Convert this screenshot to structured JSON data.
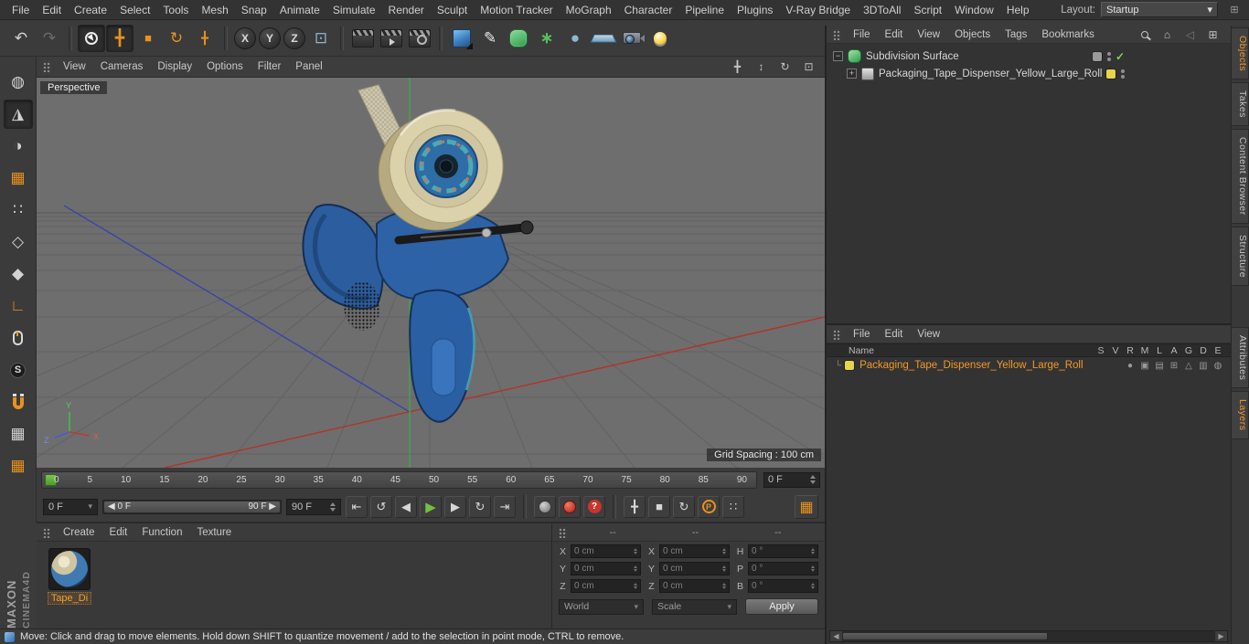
{
  "glyphs": {
    "dropdown": "▾",
    "left": "◀",
    "right": "▶"
  },
  "menubar": {
    "items": [
      "File",
      "Edit",
      "Create",
      "Select",
      "Tools",
      "Mesh",
      "Snap",
      "Animate",
      "Simulate",
      "Render",
      "Sculpt",
      "Motion Tracker",
      "MoGraph",
      "Character",
      "Pipeline",
      "Plugins",
      "V-Ray Bridge",
      "3DToAll",
      "Script",
      "Window",
      "Help"
    ],
    "layout_label": "Layout:",
    "layout_value": "Startup",
    "corner_glyph": "⊞"
  },
  "main_toolbar": {
    "items": [
      {
        "name": "undo-button",
        "icon": "undo-icon",
        "glyph": "↶",
        "cls": "lg"
      },
      {
        "name": "redo-button",
        "icon": "redo-icon",
        "glyph": "↷",
        "cls": "lg dim"
      },
      {
        "cls": "sep"
      },
      {
        "name": "live-selection-button",
        "icon": "live-selection-icon",
        "glyph": "",
        "cls": "pressed ic-livesel"
      },
      {
        "name": "move-tool-button",
        "icon": "move-tool-icon",
        "glyph": "╋",
        "cls": "orange lg pressed"
      },
      {
        "name": "scale-tool-button",
        "icon": "scale-tool-icon",
        "glyph": "■",
        "cls": "orange"
      },
      {
        "name": "rotate-tool-button",
        "icon": "rotate-tool-icon",
        "glyph": "↻",
        "cls": "orange lg"
      },
      {
        "name": "last-used-tool-button",
        "icon": "last-used-tool-icon",
        "glyph": "╋",
        "cls": "orange"
      },
      {
        "cls": "sep"
      },
      {
        "name": "lock-x-axis-button",
        "icon": "x-axis-icon",
        "glyph": "X",
        "cls": "axis"
      },
      {
        "name": "lock-y-axis-button",
        "icon": "y-axis-icon",
        "glyph": "Y",
        "cls": "axis"
      },
      {
        "name": "lock-z-axis-button",
        "icon": "z-axis-icon",
        "glyph": "Z",
        "cls": "axis"
      },
      {
        "name": "coordinate-system-button",
        "icon": "coordinate-system-icon",
        "glyph": "⊡",
        "cls": "steel lg"
      },
      {
        "cls": "sep"
      },
      {
        "name": "render-view-button",
        "icon": "render-view-icon",
        "glyph": "",
        "cls": "ic-clapper"
      },
      {
        "name": "render-picture-viewer-button",
        "icon": "render-picture-viewer-icon",
        "glyph": "",
        "cls": "ic-clapper c2"
      },
      {
        "name": "render-settings-button",
        "icon": "render-settings-icon",
        "glyph": "",
        "cls": "ic-clapper c3"
      },
      {
        "cls": "sep"
      },
      {
        "name": "add-cube-button",
        "icon": "cube-primitive-icon",
        "glyph": "",
        "cls": "ic-cube"
      },
      {
        "name": "add-spline-button",
        "icon": "spline-pen-icon",
        "glyph": "✎",
        "cls": "lg white"
      },
      {
        "name": "add-subdivision-surface-button",
        "icon": "subdivision-surface-icon",
        "glyph": "",
        "cls": "ic-sds"
      },
      {
        "name": "add-cloner-button",
        "icon": "cloner-icon",
        "glyph": "∗",
        "cls": "green lg"
      },
      {
        "name": "add-volume-button",
        "icon": "volume-sphere-icon",
        "glyph": "●",
        "cls": "steel lg"
      },
      {
        "name": "add-floor-button",
        "icon": "floor-icon",
        "glyph": "",
        "cls": "ic-floor"
      },
      {
        "name": "add-camera-button",
        "icon": "camera-icon",
        "glyph": "",
        "cls": "ic-camera"
      },
      {
        "name": "add-light-button",
        "icon": "light-bulb-icon",
        "glyph": "",
        "cls": "ic-light"
      }
    ]
  },
  "mode_toolbar": {
    "items": [
      {
        "name": "viewport-navigation-button",
        "icon": "globe-icon",
        "glyph": "◍",
        "cls": "lg"
      },
      {
        "name": "model-mode-button",
        "icon": "model-mode-icon",
        "glyph": "◮",
        "cls": "pressed lg"
      },
      {
        "name": "texture-mode-button",
        "icon": "texture-mode-icon",
        "glyph": "◑",
        "cls": "lg"
      },
      {
        "name": "workplane-mode-button",
        "icon": "workplane-icon",
        "glyph": "▦",
        "cls": "orange lg"
      },
      {
        "name": "points-mode-button",
        "icon": "points-mode-icon",
        "glyph": "∷",
        "cls": "lg"
      },
      {
        "name": "edges-mode-button",
        "icon": "edges-mode-icon",
        "glyph": "◇",
        "cls": "lg"
      },
      {
        "name": "polygons-mode-button",
        "icon": "polygons-mode-icon",
        "glyph": "◆",
        "cls": "lg"
      },
      {
        "name": "enable-axis-button",
        "icon": "axis-modification-icon",
        "glyph": "∟",
        "cls": "orange lg"
      },
      {
        "name": "viewport-solo-button",
        "icon": "mouse-icon",
        "glyph": "",
        "cls": "ic-mouse"
      },
      {
        "name": "snap-settings-button",
        "icon": "snap-s-icon",
        "glyph": "S",
        "cls": "scircle"
      },
      {
        "name": "enable-snap-button",
        "icon": "magnet-icon",
        "glyph": "",
        "cls": "ic-magnet"
      },
      {
        "name": "lock-workplane-button",
        "icon": "locked-grid-icon",
        "glyph": "▦",
        "cls": "lg"
      },
      {
        "name": "planar-workplane-button",
        "icon": "planar-grid-icon",
        "glyph": "▦",
        "cls": "orange lg"
      }
    ]
  },
  "viewport": {
    "label": "Perspective",
    "menu": [
      "View",
      "Cameras",
      "Display",
      "Options",
      "Filter",
      "Panel"
    ],
    "nav_icons": [
      {
        "name": "viewport-pan-button",
        "icon": "pan-icon",
        "glyph": "╋"
      },
      {
        "name": "viewport-zoom-button",
        "icon": "zoom-icon",
        "glyph": "↕"
      },
      {
        "name": "viewport-orbit-button",
        "icon": "orbit-icon",
        "glyph": "↻"
      },
      {
        "name": "viewport-toggle-button",
        "icon": "maximize-icon",
        "glyph": "⊡"
      }
    ],
    "grid_spacing": "Grid Spacing : 100 cm",
    "axis_labels": {
      "x": "X",
      "y": "Y",
      "z": "Z"
    }
  },
  "timeline": {
    "ticks": [
      "0",
      "5",
      "10",
      "15",
      "20",
      "25",
      "30",
      "35",
      "40",
      "45",
      "50",
      "55",
      "60",
      "65",
      "70",
      "75",
      "80",
      "85",
      "90"
    ],
    "frame_field": "0 F",
    "current_frame_label": "0 F",
    "range_start": "0 F",
    "range_end": "90 F",
    "end_field": "90 F"
  },
  "anim_toolbar": {
    "items": [
      {
        "name": "goto-start-button",
        "icon": "goto-start-icon",
        "glyph": "⇤"
      },
      {
        "name": "play-backwards-button",
        "icon": "loop-back-icon",
        "glyph": "↺"
      },
      {
        "name": "previous-frame-button",
        "icon": "previous-frame-icon",
        "glyph": "◀"
      },
      {
        "name": "play-button",
        "icon": "play-icon",
        "glyph": "▶",
        "cls": "play"
      },
      {
        "name": "next-frame-button",
        "icon": "next-frame-icon",
        "glyph": "▶"
      },
      {
        "name": "play-loop-button",
        "icon": "loop-icon",
        "glyph": "↻"
      },
      {
        "name": "goto-end-button",
        "icon": "goto-end-icon",
        "glyph": "⇥"
      },
      {
        "cls": "sep"
      },
      {
        "name": "make-preview-button",
        "icon": "preview-sphere-icon",
        "glyph": "",
        "cls": "graydot"
      },
      {
        "name": "record-objects-button",
        "icon": "record-icon",
        "glyph": "",
        "cls": "reddot"
      },
      {
        "name": "autokeying-button",
        "icon": "question-icon",
        "glyph": "?",
        "cls": "qmark"
      },
      {
        "cls": "sep"
      },
      {
        "name": "record-position-button",
        "icon": "key-position-icon",
        "glyph": "╋",
        "cls": "orange"
      },
      {
        "name": "record-scale-button",
        "icon": "key-scale-icon",
        "glyph": "■",
        "cls": "orange sm"
      },
      {
        "name": "record-rotation-button",
        "icon": "key-rotation-icon",
        "glyph": "↻",
        "cls": "orange"
      },
      {
        "name": "record-parameter-button",
        "icon": "key-parameter-icon",
        "glyph": "P",
        "cls": "pcircle"
      },
      {
        "name": "record-pla-button",
        "icon": "key-pla-icon",
        "glyph": "∷",
        "cls": "orange"
      }
    ],
    "keyframe_button_glyph": "▦"
  },
  "materials": {
    "menu": [
      "Create",
      "Edit",
      "Function",
      "Texture"
    ],
    "selected_name": "Tape_Di"
  },
  "coordinates": {
    "header_dashes": [
      "--",
      "--",
      "--"
    ],
    "rows": [
      {
        "l1": "X",
        "v1": "0 cm",
        "l2": "X",
        "v2": "0 cm",
        "l3": "H",
        "v3": "0 °"
      },
      {
        "l1": "Y",
        "v1": "0 cm",
        "l2": "Y",
        "v2": "0 cm",
        "l3": "P",
        "v3": "0 °"
      },
      {
        "l1": "Z",
        "v1": "0 cm",
        "l2": "Z",
        "v2": "0 cm",
        "l3": "B",
        "v3": "0 °"
      }
    ],
    "transform_dropdown": "World",
    "mode_dropdown": "Scale",
    "apply_label": "Apply"
  },
  "object_manager": {
    "menu": [
      "File",
      "Edit",
      "View",
      "Objects",
      "Tags",
      "Bookmarks"
    ],
    "tool_icons": [
      {
        "name": "om-search-button",
        "icon": "search-icon",
        "glyph": "",
        "cls": "ic-search"
      },
      {
        "name": "om-home-button",
        "icon": "home-icon",
        "glyph": "⌂"
      },
      {
        "name": "om-back-button",
        "icon": "back-arrow-icon",
        "glyph": "◁",
        "cls": "dim"
      },
      {
        "name": "om-frame-button",
        "icon": "frame-icon",
        "glyph": "⊞"
      }
    ],
    "rows": [
      {
        "expander": "−",
        "label": "Subdivision Surface",
        "check": "✓"
      },
      {
        "expander": "+",
        "label": "Packaging_Tape_Dispenser_Yellow_Large_Roll"
      }
    ]
  },
  "layer_manager": {
    "menu": [
      "File",
      "Edit",
      "View"
    ],
    "name_header": "Name",
    "columns": [
      "S",
      "V",
      "R",
      "M",
      "L",
      "A",
      "G",
      "D",
      "E"
    ],
    "elbow": "└",
    "row_label": "Packaging_Tape_Dispenser_Yellow_Large_Roll",
    "row_icons": [
      {
        "name": "solo-dot-icon",
        "glyph": "●"
      },
      {
        "name": "editor-visibility-icon",
        "glyph": "▣"
      },
      {
        "name": "render-visibility-icon",
        "glyph": "▤"
      },
      {
        "name": "manager-visibility-icon",
        "glyph": "⊞"
      },
      {
        "name": "lock-toggle-icon",
        "glyph": "△"
      },
      {
        "name": "animation-toggle-icon",
        "glyph": "▥"
      },
      {
        "name": "generators-toggle-icon",
        "glyph": "◍"
      }
    ]
  },
  "side_tabs": {
    "top": [
      {
        "label": "Objects",
        "cls": "active",
        "name": "tab-objects"
      },
      {
        "label": "Takes",
        "name": "tab-takes"
      },
      {
        "label": "Content Browser",
        "name": "tab-content-browser"
      },
      {
        "label": "Structure",
        "name": "tab-structure"
      }
    ],
    "bottom": [
      {
        "label": "Attributes",
        "name": "tab-attributes"
      },
      {
        "label": "Layers",
        "cls": "active",
        "name": "tab-layers"
      }
    ]
  },
  "statusbar": {
    "text": "Move: Click and drag to move elements. Hold down SHIFT to quantize movement / add to the selection in point mode, CTRL to remove."
  },
  "branding": {
    "line1": "MAXON",
    "line2": "CINEMA4D"
  }
}
